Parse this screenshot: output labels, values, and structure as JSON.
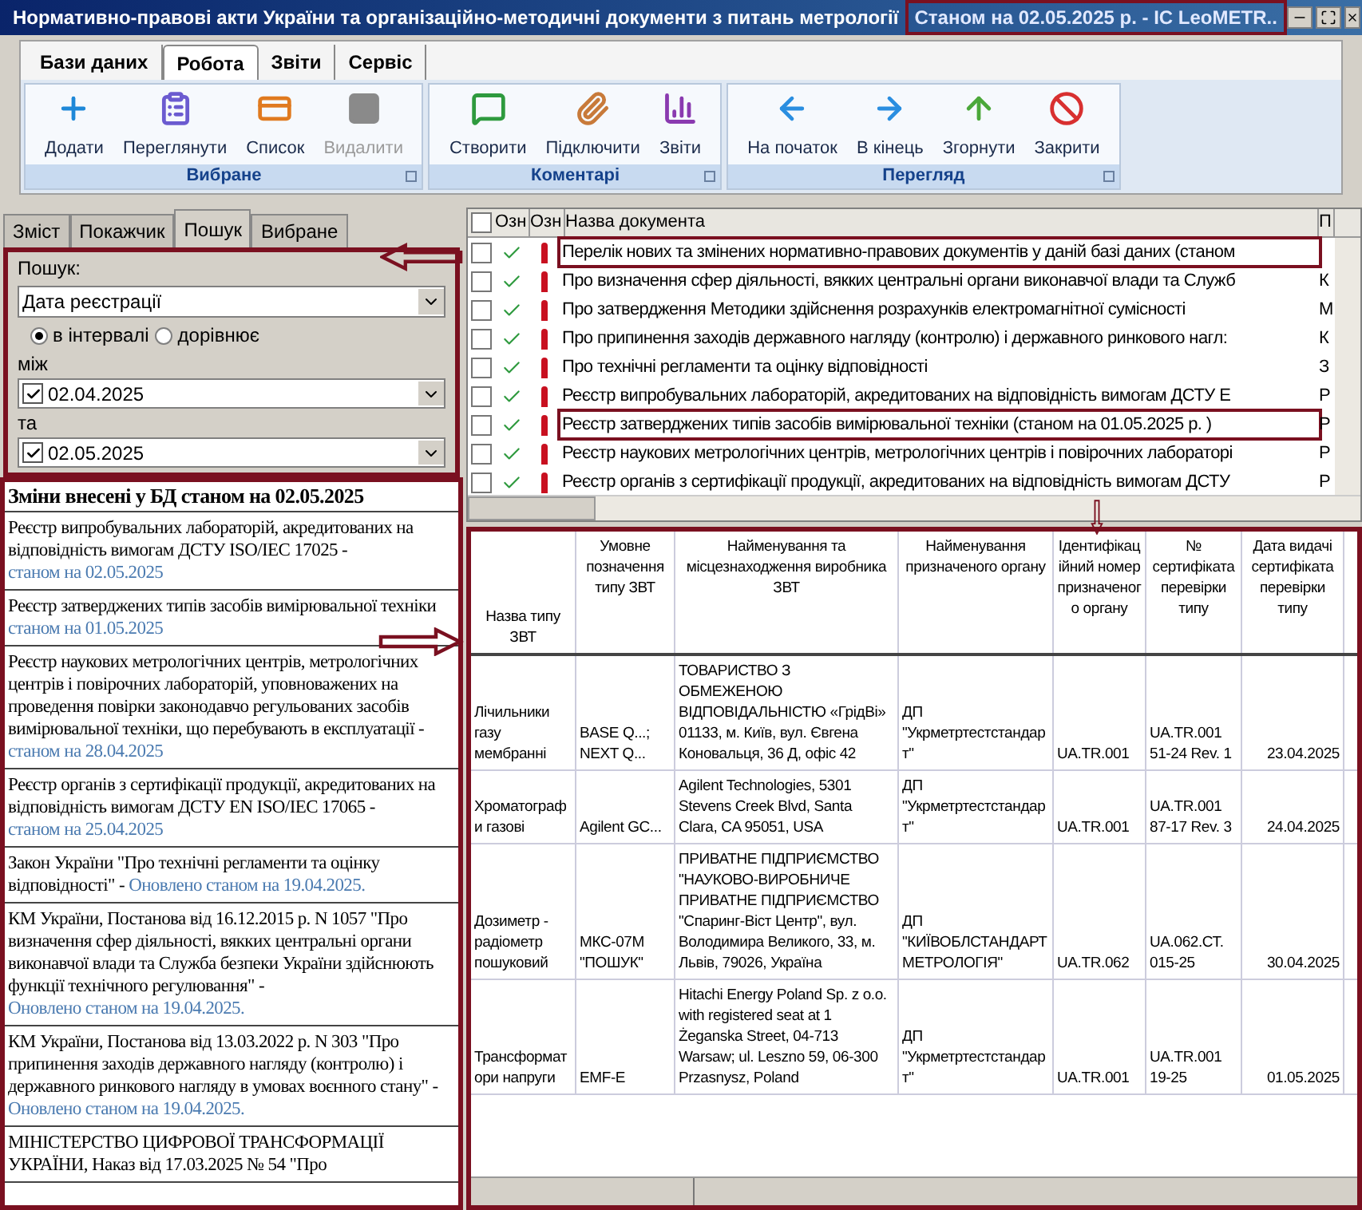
{
  "window": {
    "title": "Нормативно-правові акти України та організаційно-методичні документи з питань метрології",
    "badge": "Станом на 02.05.2025 р. - IC LeoMETR.."
  },
  "ribbon": {
    "tabs": [
      {
        "label": "Бази даних",
        "selected": false
      },
      {
        "label": "Робота",
        "selected": true
      },
      {
        "label": "Звіти",
        "selected": false
      },
      {
        "label": "Сервіс",
        "selected": false
      }
    ],
    "groups": [
      {
        "label": "Вибране",
        "buttons": [
          {
            "label": "Додати",
            "disabled": false
          },
          {
            "label": "Переглянути",
            "disabled": false
          },
          {
            "label": "Список",
            "disabled": false
          },
          {
            "label": "Видалити",
            "disabled": true
          }
        ]
      },
      {
        "label": "Коментарі",
        "buttons": [
          {
            "label": "Створити",
            "disabled": false
          },
          {
            "label": "Підключити",
            "disabled": false
          },
          {
            "label": "Звіти",
            "disabled": false
          }
        ]
      },
      {
        "label": "Перегляд",
        "buttons": [
          {
            "label": "На початок",
            "disabled": false
          },
          {
            "label": "В кінець",
            "disabled": false
          },
          {
            "label": "Згорнути",
            "disabled": false
          },
          {
            "label": "Закрити",
            "disabled": false
          }
        ]
      }
    ]
  },
  "left_tabs": [
    {
      "label": "Зміст",
      "selected": false
    },
    {
      "label": "Покажчик",
      "selected": false
    },
    {
      "label": "Пошук",
      "selected": true
    },
    {
      "label": "Вибране",
      "selected": false
    }
  ],
  "search": {
    "label": "Пошук:",
    "field": "Дата реєстрації",
    "radios": [
      {
        "label": "в інтервалі",
        "selected": true
      },
      {
        "label": "дорівнює",
        "selected": false
      }
    ],
    "from_label": "між",
    "from": {
      "value": "02.04.2025",
      "checked": true
    },
    "to_label": "та",
    "to": {
      "value": "02.05.2025",
      "checked": true
    }
  },
  "changes": {
    "title": "Зміни внесені у БД станом на 02.05.2025",
    "items": [
      {
        "text": "Реєстр випробувальних лабораторій, акредитованих на відповідність вимогам ДСТУ ISO/IEC 17025 -",
        "link": "станом на 02.05.2025"
      },
      {
        "text": "Реєстр затверджених типів засобів вимірювальної техніки",
        "link": "станом на 01.05.2025"
      },
      {
        "text": "Реєстр наукових метрологічних центрів, метрологічних центрів і повірочних лабораторій, уповноважених на проведення повірки законодавчо регульованих засобів вимірювальної техніки, що перебувають в експлуатації -",
        "link": "станом на 28.04.2025"
      },
      {
        "text": "Реєстр органів з сертифікації продукції, акредитованих на відповідність вимогам ДСТУ EN ISO/IEC 17065 -",
        "link": "станом на 25.04.2025"
      },
      {
        "text": "Закон України \"Про технічні регламенти та оцінку відповідності\" -",
        "link": "Оновлено станом на 19.04.2025."
      },
      {
        "text": "КМ України, Постанова від 16.12.2015 р. N 1057 \"Про визначення сфер діяльності, вякких центральні органи виконавчої влади та Служба безпеки України здійснюють функції технічного регулювання\" -",
        "link": "Оновлено станом на 19.04.2025."
      },
      {
        "text": "КМ України, Постанова від 13.03.2022 р. N 303 \"Про припинення заходів державного нагляду (контролю) і державного ринкового нагляду в умовах воєнного стану\" -",
        "link": "Оновлено станом на 19.04.2025."
      },
      {
        "text": "МІНІСТЕРСТВО ЦИФРОВОЇ ТРАНСФОРМАЦІЇ УКРАЇНИ, Наказ від 17.03.2025 № 54 \"Про"
      }
    ]
  },
  "documents": {
    "all_checked": false,
    "columns": [
      "Озн",
      "Озн",
      "Назва документа",
      "П"
    ],
    "rows": [
      {
        "checked": false,
        "highlighted": true,
        "name": "Перелік нових та змінених нормативно-правових документів у даній базі даних (станом"
      },
      {
        "checked": false,
        "highlighted": false,
        "name": "Про визначення сфер діяльності, вякких центральні органи виконавчої влади та Служб",
        "column_4": "К"
      },
      {
        "checked": false,
        "highlighted": false,
        "name": "Про затвердження Методики здійснення розрахунків електромагнітної сумісності",
        "column_4": "М"
      },
      {
        "checked": false,
        "highlighted": false,
        "name": "Про припинення заходів державного нагляду (контролю) і державного ринкового нагл:",
        "column_4": "К"
      },
      {
        "checked": false,
        "highlighted": false,
        "name": "Про технічні регламенти та оцінку відповідності",
        "column_4": "З"
      },
      {
        "checked": false,
        "highlighted": false,
        "name": "Реєстр випробувальних лабораторій, акредитованих на відповідність вимогам ДСТУ Е",
        "column_4": "Р"
      },
      {
        "checked": false,
        "highlighted": true,
        "name": "Реєстр затверджених типів засобів вимірювальної техніки  (станом на 01.05.2025 р. )",
        "column_4": "Р"
      },
      {
        "checked": false,
        "highlighted": false,
        "name": "Реєстр наукових метрологічних центрів, метрологічних центрів і повірочних лабораторі",
        "column_4": "Р"
      },
      {
        "checked": false,
        "highlighted": false,
        "name": "Реєстр органів з сертифікації продукції, акредитованих на відповідність вимогам ДСТУ",
        "column_4": "Р"
      }
    ]
  },
  "table": {
    "columns": [
      "Назва типу ЗВТ",
      "Умовне позначення типу ЗВТ",
      "Найменування та місцезнаходження виробника ЗВТ",
      "Найменування призначеного органу",
      "Ідентифікаційний номер призначеного органу",
      "№ сертифіката перевірки типу",
      "Дата видачі сертифіката перевірки типу"
    ],
    "rows": [
      [
        "Лічильники газу мембранні",
        "BASE Q...; NEXT Q...",
        "ТОВАРИСТВО З ОБМЕЖЕНОЮ ВІДПОВІДАЛЬНІСТЮ «ГрідВі»  01133, м. Київ, вул. Євгена Коновальця, 36 Д, офіс 42",
        "ДП \"Укрметртестстандарт\"",
        "UA.TR.001",
        "UA.TR.001 51-24 Rev. 1",
        "23.04.2025"
      ],
      [
        "Хроматографи газові",
        "Agilent GC...",
        "Agilent Technologies, 5301 Stevens Creek Blvd, Santa Clara, CA 95051, USA",
        "ДП \"Укрметртестстандарт\"",
        "UA.TR.001",
        "UA.TR.001 87-17 Rev. 3",
        "24.04.2025"
      ],
      [
        "Дозиметр - радіометр пошуковий",
        "МКС-07М \"ПОШУК\"",
        "ПРИВАТНЕ ПІДПРИЄМСТВО \"НАУКОВО-ВИРОБНИЧЕ ПРИВАТНЕ ПІДПРИЄМСТВО \"Спаринг-Віст Центр\", вул. Володимира Великого, 33, м. Львів, 79026, Україна",
        "ДП \"КИЇВОБЛСТАНДАРТ МЕТРОЛОГІЯ\"",
        "UA.TR.062",
        "UA.062.СТ. 015-25",
        "30.04.2025"
      ],
      [
        "Трансформатори напруги",
        "EMF-E",
        "Hitachi Energy Poland Sp. z o.o.  with registered seat at 1 Żeganska Street, 04-713 Warsaw;  ul. Leszno 59, 06-300 Przasnysz, Poland",
        "ДП \"Укрметртестстандарт\"",
        "UA.TR.001",
        "UA.TR.001 19-25",
        "01.05.2025"
      ]
    ]
  }
}
